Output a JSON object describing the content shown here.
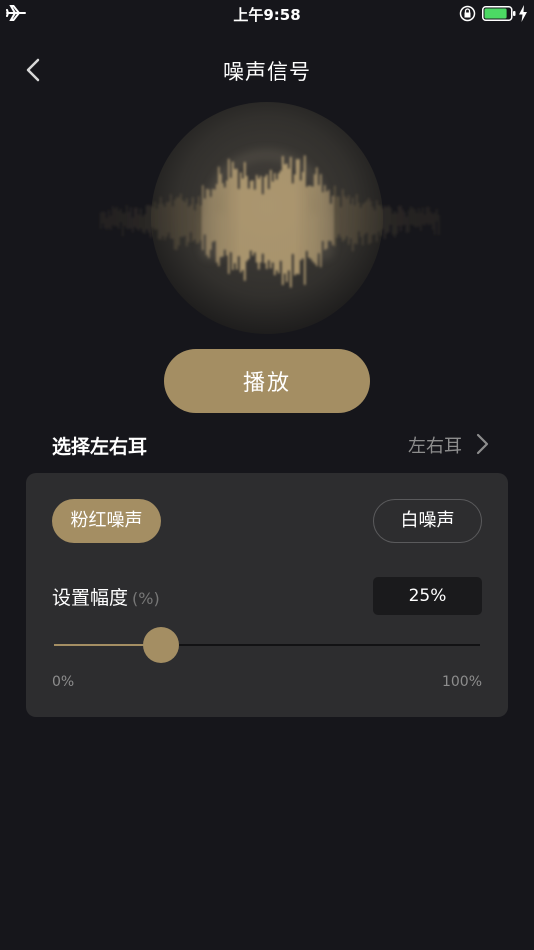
{
  "status_bar": {
    "time": "上午9:58",
    "battery_level": 0.85,
    "charging": true,
    "icons": [
      "airplane-icon",
      "orientation-lock-icon",
      "battery-icon",
      "charging-bolt-icon"
    ]
  },
  "nav": {
    "title": "噪声信号",
    "back_icon": "chevron-left-icon"
  },
  "visual": {
    "icon": "headphones-waveform-icon",
    "colors": {
      "glow": "#b39a6c",
      "circle": "#3a3834"
    }
  },
  "play_button": {
    "label": "播放"
  },
  "ear_select": {
    "label": "选择左右耳",
    "value": "左右耳",
    "icon": "chevron-right-icon"
  },
  "noise_type": {
    "options": [
      {
        "label": "粉红噪声",
        "selected": true
      },
      {
        "label": "白噪声",
        "selected": false
      }
    ]
  },
  "amplitude": {
    "label": "设置幅度",
    "unit": "(%)",
    "value_text": "25%",
    "value": 25,
    "min_label": "0%",
    "max_label": "100%"
  },
  "colors": {
    "background": "#16161b",
    "panel": "#2d2d2f",
    "accent": "#a48e63",
    "muted_text": "#8d8d8d"
  }
}
